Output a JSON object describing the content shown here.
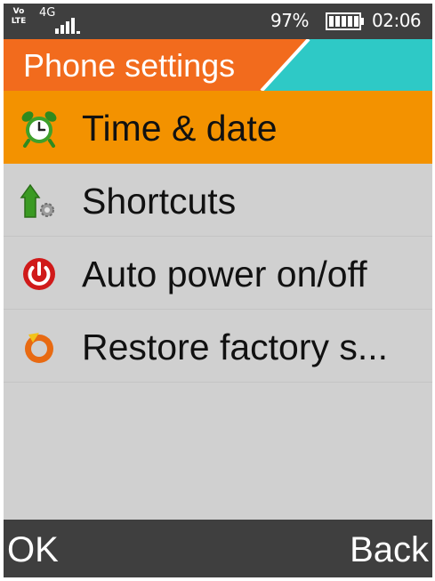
{
  "status_bar": {
    "volte_top": "Vo",
    "volte_bottom": "LTE",
    "network": "4G",
    "signal_icon": "signal-bars-icon",
    "battery_percent": "97%",
    "battery_icon": "battery-full-icon",
    "time": "02:06"
  },
  "header": {
    "title": "Phone settings",
    "accent_color": "#f26b1d",
    "secondary_color": "#2ec9c6"
  },
  "menu": {
    "selected_index": 0,
    "selected_color": "#f39200",
    "items": [
      {
        "label": "Time & date",
        "icon": "alarm-clock-icon"
      },
      {
        "label": "Shortcuts",
        "icon": "shortcut-arrow-gear-icon"
      },
      {
        "label": "Auto power on/off",
        "icon": "power-icon"
      },
      {
        "label": "Restore factory s...",
        "icon": "restore-icon"
      }
    ]
  },
  "softkeys": {
    "left": "OK",
    "right": "Back"
  }
}
